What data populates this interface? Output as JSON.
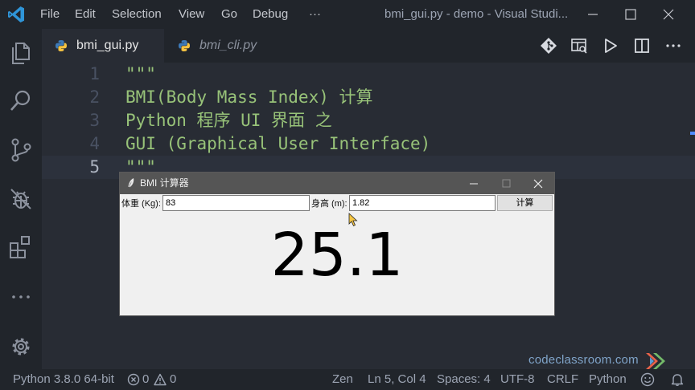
{
  "titlebar": {
    "menu": [
      "File",
      "Edit",
      "Selection",
      "View",
      "Go",
      "Debug",
      "···"
    ],
    "title": "bmi_gui.py - demo - Visual Studi..."
  },
  "tabs": [
    {
      "label": "bmi_gui.py",
      "active": true
    },
    {
      "label": "bmi_cli.py",
      "active": false
    }
  ],
  "editor": {
    "lines": [
      {
        "num": "1",
        "text": "\"\"\""
      },
      {
        "num": "2",
        "text": "BMI(Body Mass Index) 计算"
      },
      {
        "num": "3",
        "text": "Python 程序 UI 界面 之"
      },
      {
        "num": "4",
        "text": "GUI (Graphical User Interface)"
      },
      {
        "num": "5",
        "text": "\"\"\""
      }
    ],
    "string_color": "#98c379"
  },
  "tk_window": {
    "title": "BMI 计算器",
    "weight_label": "体重 (Kg):",
    "weight_value": "83",
    "height_label": "身高 (m):",
    "height_value": "1.82",
    "calc_button": "计算",
    "result": "25.1"
  },
  "watermark": {
    "text": "codeclassroom.com"
  },
  "statusbar": {
    "interpreter": "Python 3.8.0 64-bit",
    "errors": "0",
    "warnings": "0",
    "zen": "Zen",
    "position": "Ln 5, Col 4",
    "spaces": "Spaces: 4",
    "encoding": "UTF-8",
    "eol": "CRLF",
    "language": "Python"
  },
  "colors": {
    "accent": "#007acc",
    "background": "#282c34",
    "chrome": "#21252b"
  }
}
